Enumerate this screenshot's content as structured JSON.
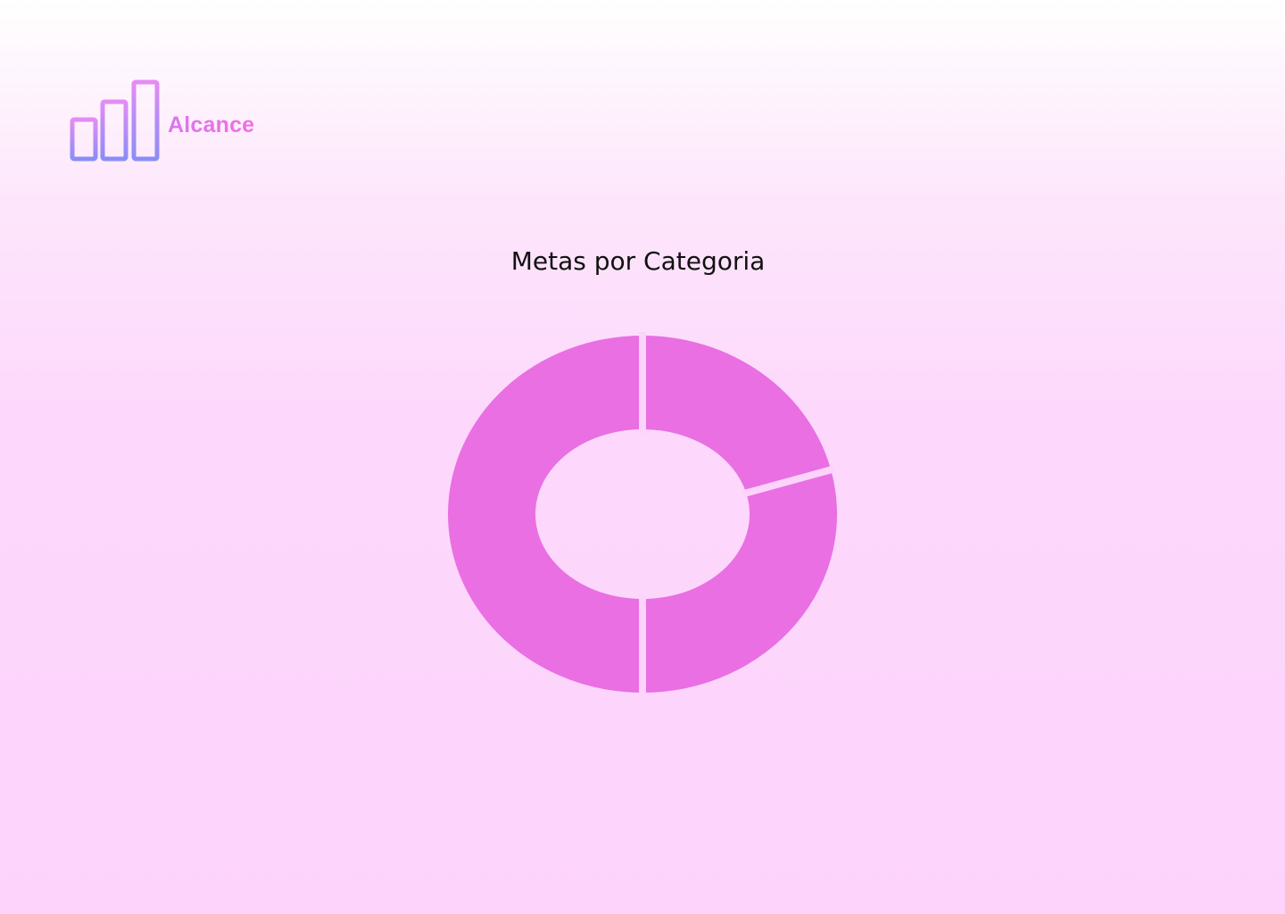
{
  "brand": {
    "name": "Alcance",
    "logo_icon": "bar-chart-logo-icon",
    "gradient_colors": [
      "#8a8df7",
      "#e48cf3"
    ]
  },
  "chart_data": {
    "type": "pie",
    "title": "Metas por Categoria",
    "donut": true,
    "slices": [
      {
        "value": 21
      },
      {
        "value": 29
      },
      {
        "value": 50
      }
    ],
    "slice_color": "#e96fe3",
    "separator_color": "#fcd3fa",
    "legend": "none"
  }
}
